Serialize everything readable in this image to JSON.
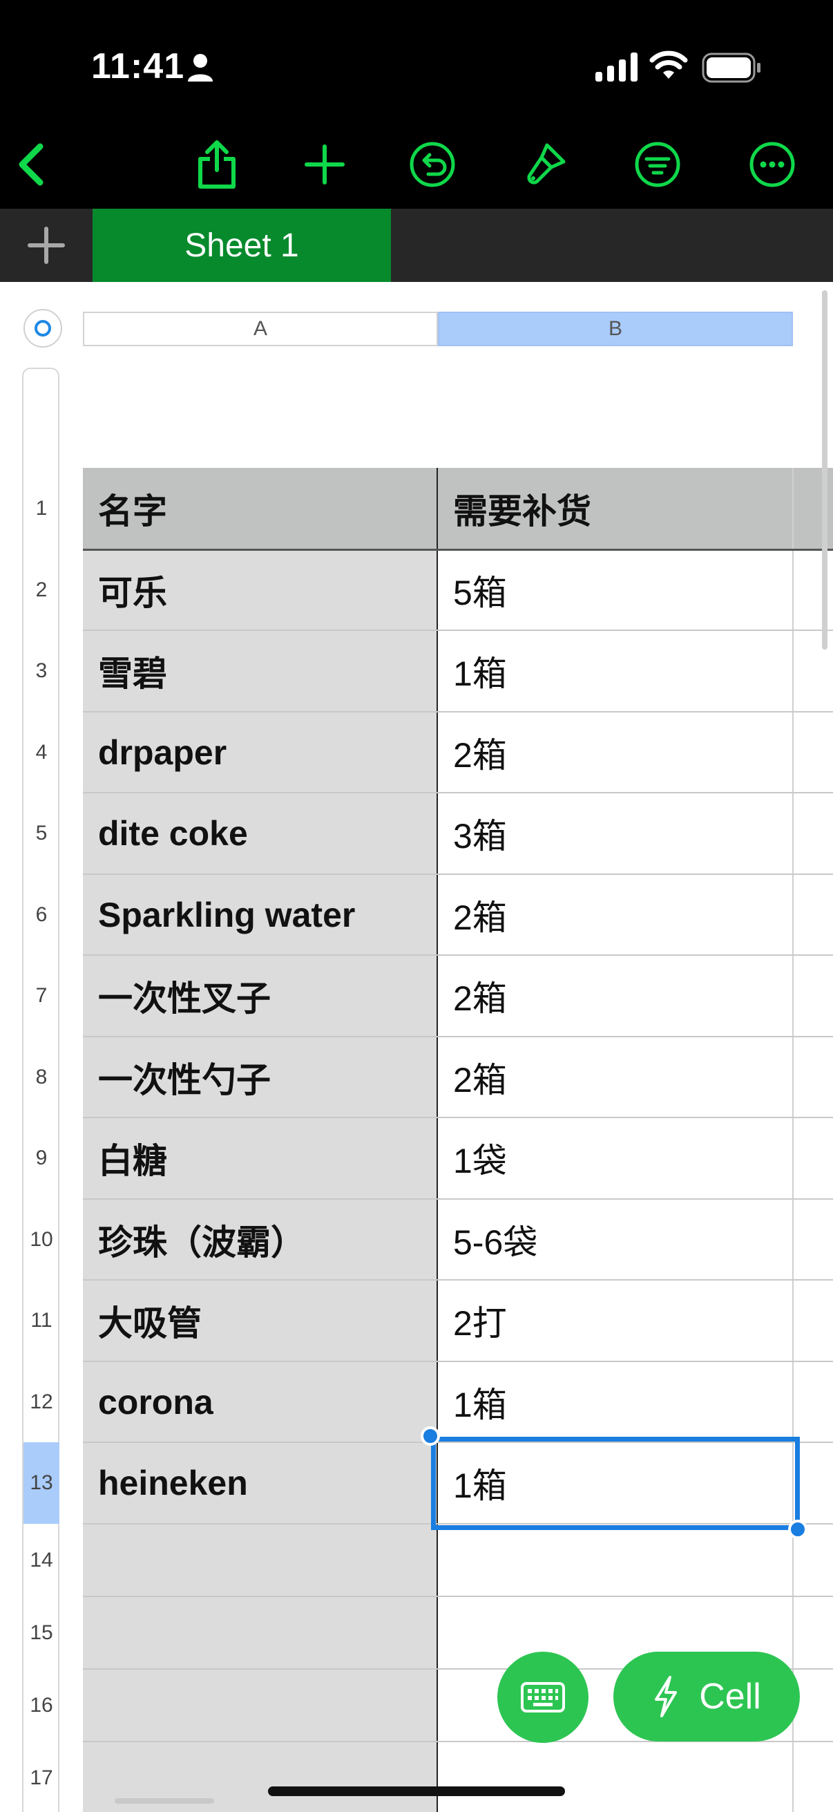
{
  "status_bar": {
    "time": "11:41"
  },
  "icons": {
    "person": "person-icon",
    "signal": "cellular-signal-icon",
    "wifi": "wifi-icon",
    "battery": "battery-icon",
    "back": "chevron-left-icon",
    "share": "share-icon",
    "add": "plus-icon",
    "undo": "undo-icon",
    "format": "paintbrush-icon",
    "organize": "filter-icon",
    "more": "ellipsis-icon",
    "add_sheet": "plus-icon",
    "keyboard": "keyboard-icon",
    "quick_cell": "lightning-icon"
  },
  "colors": {
    "accent": "#0fd84a",
    "tab_active": "#078a2c",
    "selection": "#1a7de0",
    "fab": "#2dc552"
  },
  "tabs": [
    {
      "label": "Sheet 1",
      "active": true
    }
  ],
  "columns": [
    {
      "label": "A",
      "selected": false
    },
    {
      "label": "B",
      "selected": true
    }
  ],
  "rows": [
    {
      "num": "1",
      "a": "名字",
      "b": "需要补货"
    },
    {
      "num": "2",
      "a": "可乐",
      "b": "5箱"
    },
    {
      "num": "3",
      "a": "雪碧",
      "b": "1箱"
    },
    {
      "num": "4",
      "a": "drpaper",
      "b": "2箱"
    },
    {
      "num": "5",
      "a": "dite coke",
      "b": "3箱"
    },
    {
      "num": "6",
      "a": "Sparkling water",
      "b": "2箱"
    },
    {
      "num": "7",
      "a": "一次性叉子",
      "b": "2箱"
    },
    {
      "num": "8",
      "a": "一次性勺子",
      "b": "2箱"
    },
    {
      "num": "9",
      "a": "白糖",
      "b": "1袋"
    },
    {
      "num": "10",
      "a": "珍珠（波霸）",
      "b": "5-6袋"
    },
    {
      "num": "11",
      "a": "大吸管",
      "b": "2打"
    },
    {
      "num": "12",
      "a": "corona",
      "b": "1箱"
    },
    {
      "num": "13",
      "a": "heineken",
      "b": "1箱"
    },
    {
      "num": "14",
      "a": "",
      "b": ""
    },
    {
      "num": "15",
      "a": "",
      "b": ""
    },
    {
      "num": "16",
      "a": "",
      "b": ""
    },
    {
      "num": "17",
      "a": "",
      "b": ""
    }
  ],
  "selected_cell": "B13",
  "buttons": {
    "cell_label": "Cell"
  }
}
